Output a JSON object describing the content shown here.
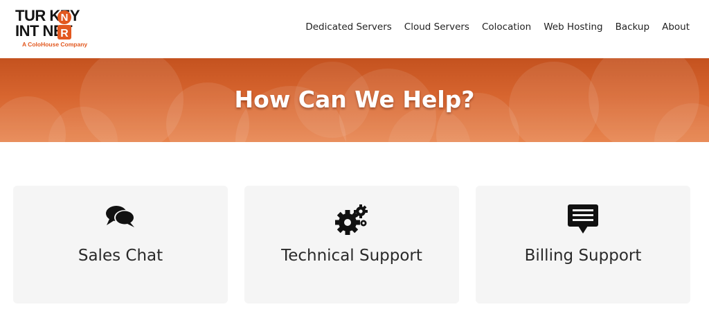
{
  "logo": {
    "line1": "TUR  KEY",
    "line2": "INT   NET",
    "tagline": "A ColoHouse Company"
  },
  "nav": {
    "items": [
      "Dedicated Servers",
      "Cloud Servers",
      "Colocation",
      "Web Hosting",
      "Backup",
      "About"
    ]
  },
  "hero": {
    "title": "How Can We Help?"
  },
  "cards": [
    {
      "label": "Sales Chat",
      "icon": "chat-bubbles-icon"
    },
    {
      "label": "Technical Support",
      "icon": "gears-icon"
    },
    {
      "label": "Billing Support",
      "icon": "message-icon"
    }
  ],
  "colors": {
    "brand_orange": "#e2581f",
    "hero_top": "#c4521f",
    "hero_bottom": "#e7844e",
    "card_bg": "#f5f5f5"
  }
}
